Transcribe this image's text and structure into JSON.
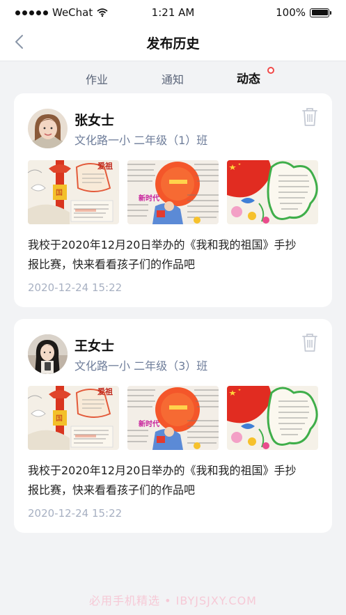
{
  "status_bar": {
    "carrier": "WeChat",
    "time": "1:21 AM",
    "battery": "100%",
    "battery_level": 1.0
  },
  "nav": {
    "back_icon": "chevron-left-icon",
    "title": "发布历史"
  },
  "tabs": [
    {
      "label": "作业",
      "active": false
    },
    {
      "label": "通知",
      "active": false
    },
    {
      "label": "动态",
      "active": true,
      "badge": "red-dot"
    }
  ],
  "posts": [
    {
      "author": "张女士",
      "school": "文化路一小 二年级（1）班",
      "text_line1": "我校于2020年12月20日举办的《我和我的祖国》手抄",
      "text_line2": "报比赛，快来看看孩子们的作品吧",
      "time": "2020-12-24  15:22",
      "delete_icon": "trash-icon",
      "thumbnails": [
        "handwritten-poster-1",
        "handwritten-poster-2",
        "handwritten-poster-3"
      ]
    },
    {
      "author": "王女士",
      "school": "文化路一小 二年级（3）班",
      "text_line1": "我校于2020年12月20日举办的《我和我的祖国》手抄",
      "text_line2": "报比赛，快来看看孩子们的作品吧",
      "time": "2020-12-24  15:22",
      "delete_icon": "trash-icon",
      "thumbnails": [
        "handwritten-poster-1",
        "handwritten-poster-2",
        "handwritten-poster-3"
      ]
    }
  ],
  "watermark": "必用手机精选 • IBYJSJXY.COM",
  "colors": {
    "background": "#f2f3f5",
    "card": "#ffffff",
    "accent_red": "#f04848",
    "secondary_text": "#6e7d9a",
    "muted_text": "#a7b0c2"
  }
}
